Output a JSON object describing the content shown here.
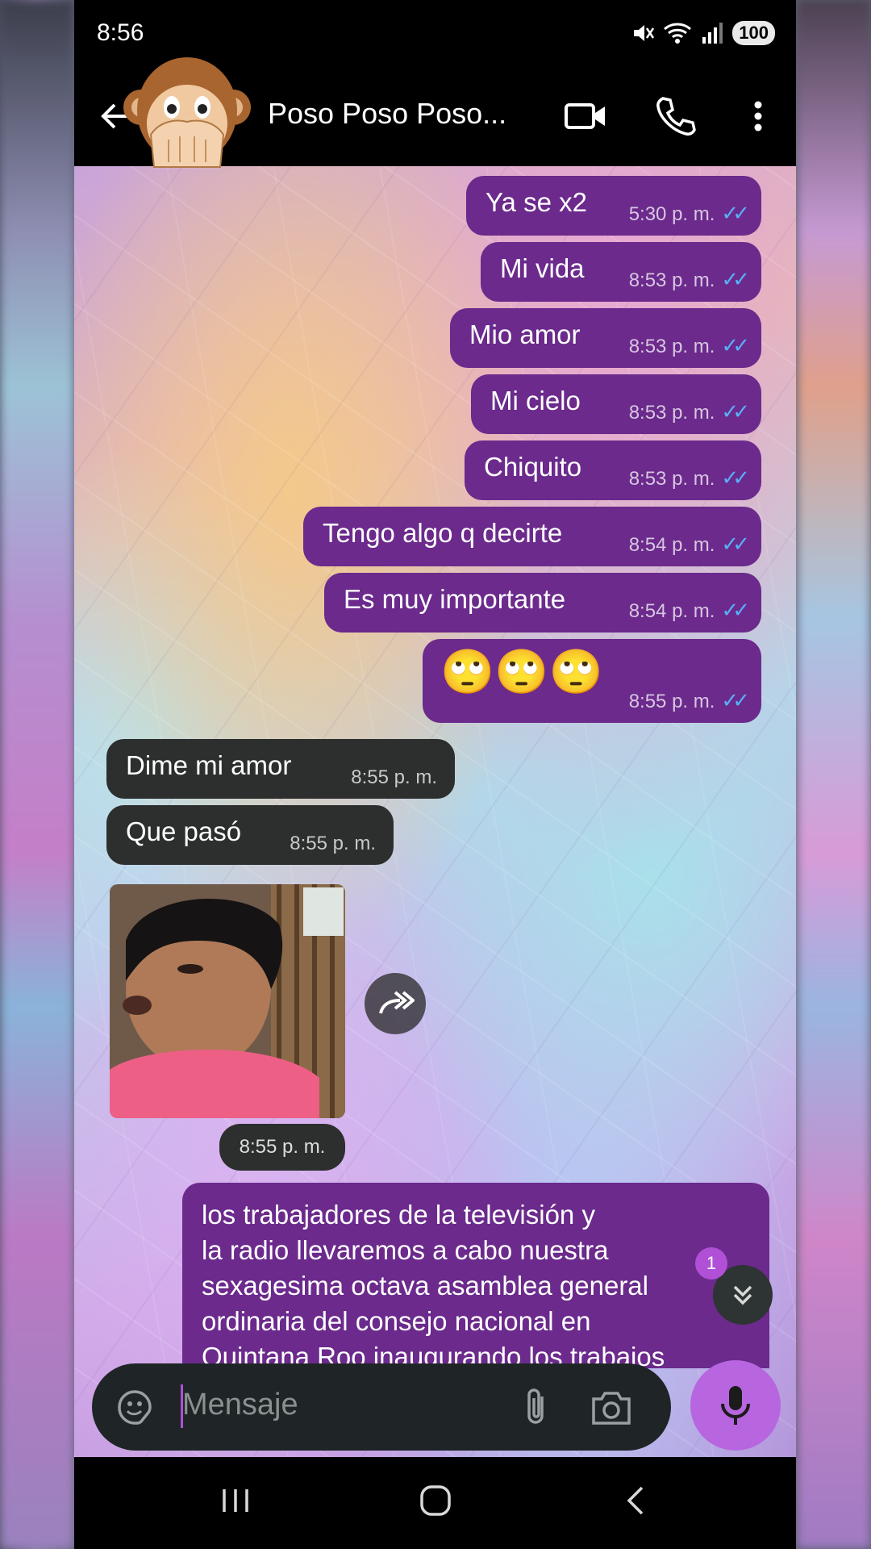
{
  "status_bar": {
    "time": "8:56",
    "battery": "100"
  },
  "header": {
    "title": "Poso Poso Poso..."
  },
  "messages_out": [
    {
      "text": "Ya se x2",
      "time": "5:30 p. m."
    },
    {
      "text": "Mi vida",
      "time": "8:53 p. m."
    },
    {
      "text": "Mio amor",
      "time": "8:53 p. m."
    },
    {
      "text": "Mi cielo",
      "time": "8:53 p. m."
    },
    {
      "text": "Chiquito",
      "time": "8:53 p. m."
    },
    {
      "text": "Tengo algo q decirte",
      "time": "8:54 p. m."
    },
    {
      "text": "Es muy importante",
      "time": "8:54 p. m."
    },
    {
      "text": "🙄🙄🙄",
      "time": "8:55 p. m."
    }
  ],
  "messages_in": [
    {
      "text": "Dime mi amor",
      "time": "8:55 p. m."
    },
    {
      "text": "Que pasó",
      "time": "8:55 p. m."
    }
  ],
  "photo_message": {
    "time": "8:55 p. m."
  },
  "long_message": {
    "lines": [
      "los trabajadores de la televisión y",
      "la radio llevaremos a cabo nuestra",
      "sexagesima octava asamblea general",
      "ordinaria del consejo nacional en",
      "Quintana Roo inaugurando los trabajos"
    ]
  },
  "unread_count": "1",
  "composer": {
    "placeholder": "Mensaje"
  },
  "colors": {
    "outgoing_bubble": "#6b2a8c",
    "incoming_bubble": "#2d2f2f",
    "read_ticks": "#5aaef5",
    "mic_button": "#b766e0"
  },
  "icons": [
    "back-arrow-icon",
    "video-call-icon",
    "phone-icon",
    "more-vert-icon",
    "sticker-icon",
    "attach-icon",
    "camera-icon",
    "mic-icon",
    "forward-icon",
    "double-chevron-down-icon",
    "recents-icon",
    "home-icon",
    "nav-back-icon"
  ]
}
